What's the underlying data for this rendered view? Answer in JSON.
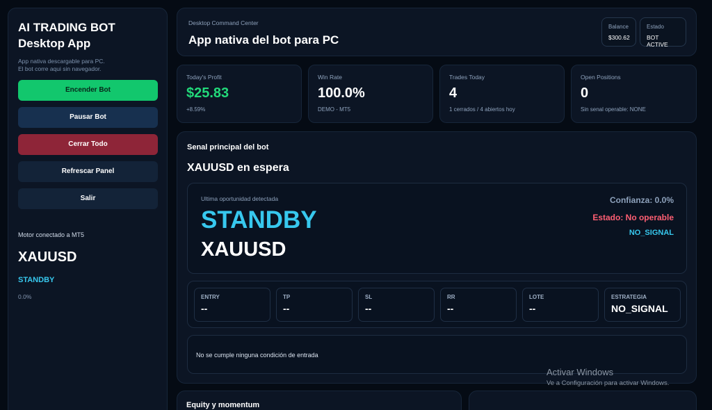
{
  "sidebar": {
    "title_line1": "AI TRADING BOT",
    "title_line2": "Desktop App",
    "subtitle_line1": "App nativa descargable para PC.",
    "subtitle_line2": "El bot corre aqui sin navegador.",
    "buttons": {
      "start": "Encender Bot",
      "pause": "Pausar Bot",
      "close_all": "Cerrar Todo",
      "refresh": "Refrescar Panel",
      "exit": "Salir"
    },
    "motor_label": "Motor conectado a MT5",
    "symbol": "XAUUSD",
    "status": "STANDBY",
    "confidence": "0.0%"
  },
  "header": {
    "kicker": "Desktop Command Center",
    "title": "App nativa del bot para PC",
    "balance_label": "Balance",
    "balance_value": "$300.62",
    "estado_label": "Estado",
    "estado_value": "BOT ACTIVE"
  },
  "stats": [
    {
      "label": "Today's Profit",
      "value": "$25.83",
      "sub": "+8.59%"
    },
    {
      "label": "Win Rate",
      "value": "100.0%",
      "sub": "DEMO - MT5"
    },
    {
      "label": "Trades Today",
      "value": "4",
      "sub": "1 cerrados / 4 abiertos hoy"
    },
    {
      "label": "Open Positions",
      "value": "0",
      "sub": "Sin senal operable: NONE"
    }
  ],
  "signal": {
    "heading": "Senal principal del bot",
    "symbol_line": "XAUUSD en espera",
    "opportunity_label": "Ultima oportunidad detectada",
    "state_big": "STANDBY",
    "symbol_big": "XAUUSD",
    "confidence": "Confianza: 0.0%",
    "estado": "Estado: No operable",
    "signal_code": "NO_SIGNAL",
    "metrics": [
      {
        "label": "ENTRY",
        "value": "--"
      },
      {
        "label": "TP",
        "value": "--"
      },
      {
        "label": "SL",
        "value": "--"
      },
      {
        "label": "RR",
        "value": "--"
      },
      {
        "label": "LOTE",
        "value": "--"
      },
      {
        "label": "ESTRATEGIA",
        "value": "NO_SIGNAL"
      }
    ],
    "condition": "No se cumple ninguna condición de entrada"
  },
  "bottom": {
    "equity_title": "Equity y momentum"
  },
  "watermark": {
    "line1": "Activar Windows",
    "line2": "Ve a Configuración para activar Windows."
  },
  "colors": {
    "accent_green": "#12c76d",
    "accent_cyan": "#37c8ee",
    "danger": "#ff5f73",
    "background": "#050b14"
  }
}
